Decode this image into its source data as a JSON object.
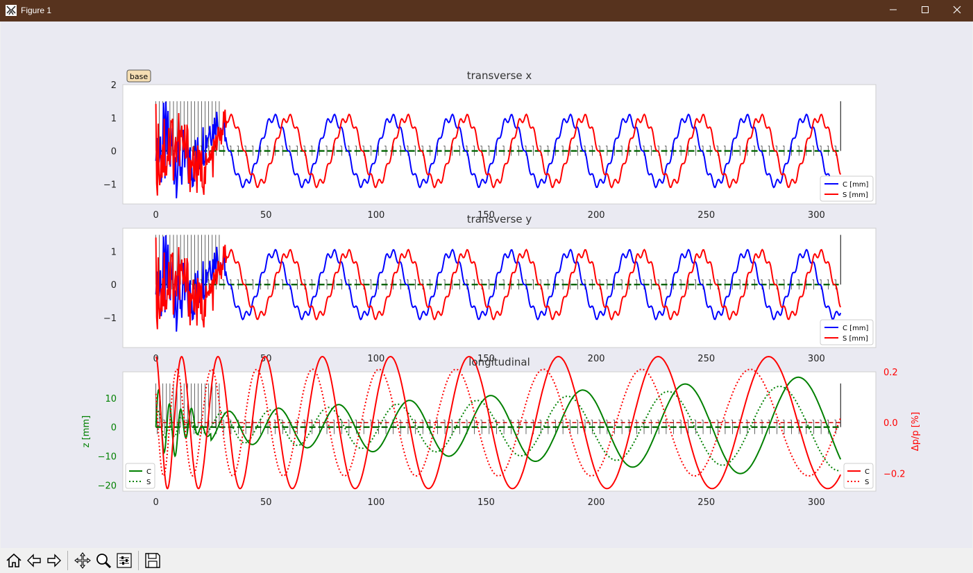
{
  "window": {
    "title": "Figure 1",
    "minimize": "—",
    "maximize": "☐",
    "close": "✕"
  },
  "base_button": "base",
  "toolbar": [
    "home-icon",
    "back-icon",
    "forward-icon",
    "pan-icon",
    "zoom-icon",
    "configure-icon",
    "save-icon"
  ],
  "colors": {
    "titlebar": "#57331e",
    "c": "#0000ff",
    "s": "#ff0000",
    "z": "#008000",
    "dp": "#ff0000"
  },
  "chart_data": [
    {
      "type": "line",
      "title": "transverse x",
      "xlim": [
        -15,
        327
      ],
      "ylim": [
        -1.6,
        2.0
      ],
      "xticks": [
        0,
        50,
        100,
        150,
        200,
        250,
        300
      ],
      "yticks": [
        {
          "v": 2,
          "label": "2"
        },
        {
          "v": 1,
          "label": "1"
        },
        {
          "v": 0,
          "label": "0"
        },
        {
          "v": -1,
          "label": "−1"
        }
      ],
      "legend": "lower-right",
      "period": 26.8,
      "amplitude": 1.0,
      "series": [
        {
          "name": "C  [mm]",
          "color": "#0000ff"
        },
        {
          "name": "S  [mm]",
          "color": "#ff0000"
        }
      ]
    },
    {
      "type": "line",
      "title": "transverse y",
      "xlim": [
        -15,
        327
      ],
      "ylim": [
        -1.9,
        1.7
      ],
      "xticks": [
        0,
        50,
        100,
        150,
        200,
        250,
        300
      ],
      "yticks": [
        {
          "v": 1,
          "label": "1"
        },
        {
          "v": 0,
          "label": "0"
        },
        {
          "v": -1,
          "label": "−1"
        }
      ],
      "legend": "lower-right",
      "period": 26.8,
      "amplitude": 0.95,
      "series": [
        {
          "name": "C  [mm]",
          "color": "#0000ff"
        },
        {
          "name": "S  [mm]",
          "color": "#ff0000"
        }
      ]
    },
    {
      "type": "line",
      "title": "longitudinal",
      "xlim": [
        -15,
        327
      ],
      "ylim": [
        -22,
        19
      ],
      "y2lim": [
        -0.27,
        0.2
      ],
      "xticks": [
        0,
        50,
        100,
        150,
        200,
        250,
        300
      ],
      "yticks": [
        {
          "v": 10,
          "label": "10"
        },
        {
          "v": 0,
          "label": "0"
        },
        {
          "v": -10,
          "label": "−10"
        },
        {
          "v": -20,
          "label": "−20"
        }
      ],
      "y2ticks": [
        {
          "v": 0.2,
          "label": "0.2"
        },
        {
          "v": 0.0,
          "label": "0.0"
        },
        {
          "v": -0.2,
          "label": "−0.2"
        }
      ],
      "ylabel": "z [mm]",
      "y2label": "Δp/p [%]",
      "legend_left": "lower-left",
      "legend_right": "lower-right",
      "series": [
        {
          "name": "C",
          "axis": "left",
          "color": "#008000",
          "dash": "solid",
          "amp_start": 4,
          "amp_end": 18
        },
        {
          "name": "S",
          "axis": "left",
          "color": "#008000",
          "dash": "dotted",
          "amp_start": 4,
          "amp_end": 15
        },
        {
          "name": "C",
          "axis": "right",
          "color": "#ff0000",
          "dash": "solid",
          "amp": 0.26
        },
        {
          "name": "S",
          "axis": "right",
          "color": "#ff0000",
          "dash": "dotted",
          "amp": 0.21
        }
      ]
    }
  ]
}
